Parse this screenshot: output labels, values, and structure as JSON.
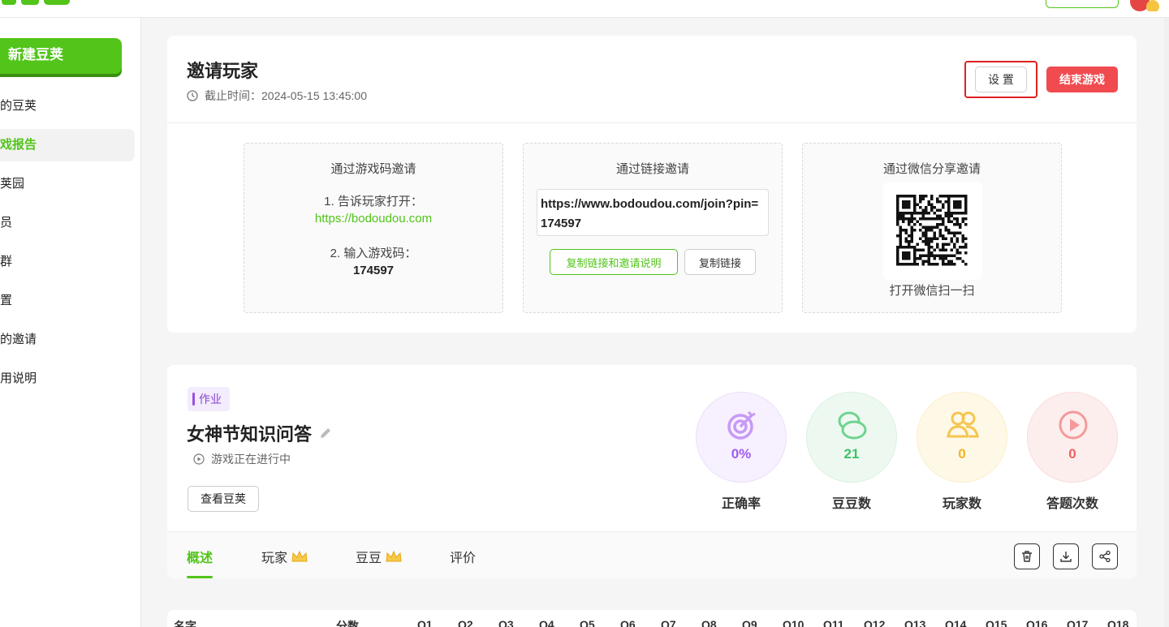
{
  "header": {
    "logo_icon": "doudou-logo",
    "colors": {
      "brand_green": "#52c41a",
      "danger_red": "#f04c50",
      "highlight_red": "#e02020"
    }
  },
  "sidebar": {
    "new_button": "新建豆荚",
    "items": [
      {
        "label": "的豆荚",
        "active": false
      },
      {
        "label": "戏报告",
        "active": true
      },
      {
        "label": "荚园",
        "active": false
      },
      {
        "label": "员",
        "active": false
      },
      {
        "label": "群",
        "active": false
      },
      {
        "label": "置",
        "active": false
      },
      {
        "label": "的邀请",
        "active": false
      },
      {
        "label": "用说明",
        "active": false
      }
    ]
  },
  "invite": {
    "title": "邀请玩家",
    "deadline": "截止时间：2024-05-15 13:45:00",
    "settings_button": "设 置",
    "end_button": "结束游戏",
    "by_code": {
      "title": "通过游戏码邀请",
      "step1": "1. 告诉玩家打开：",
      "step1_link": "https://bodoudou.com",
      "step2": "2. 输入游戏码：",
      "code": "174597"
    },
    "by_link": {
      "title": "通过链接邀请",
      "url": "https://www.bodoudou.com/join?pin=174597",
      "copy_with_instructions": "复制链接和邀请说明",
      "copy_link": "复制链接"
    },
    "by_wechat": {
      "title": "通过微信分享邀请",
      "caption": "打开微信扫一扫"
    }
  },
  "game": {
    "tag": "作业",
    "title": "女神节知识问答",
    "status": "游戏正在进行中",
    "view_button": "查看豆荚",
    "stats": [
      {
        "label": "正确率",
        "value": "0%",
        "icon": "target-icon",
        "color": "#a05cf0",
        "bg": "#f7f0fe"
      },
      {
        "label": "豆豆数",
        "value": "21",
        "icon": "beans-icon",
        "color": "#3fc06a",
        "bg": "#edf9f0"
      },
      {
        "label": "玩家数",
        "value": "0",
        "icon": "users-icon",
        "color": "#f5b325",
        "bg": "#fef8e6"
      },
      {
        "label": "答题次数",
        "value": "0",
        "icon": "play-icon",
        "color": "#f06060",
        "bg": "#fdeeee"
      }
    ],
    "tabs": [
      {
        "label": "概述",
        "active": true,
        "premium": false
      },
      {
        "label": "玩家",
        "active": false,
        "premium": true
      },
      {
        "label": "豆豆",
        "active": false,
        "premium": true
      },
      {
        "label": "评价",
        "active": false,
        "premium": false
      }
    ],
    "tools": [
      "trash-icon",
      "download-icon",
      "share-icon"
    ]
  },
  "table": {
    "columns": [
      "名字",
      "分数",
      "Q1",
      "Q2",
      "Q3",
      "Q4",
      "Q5",
      "Q6",
      "Q7",
      "Q8",
      "Q9",
      "Q10",
      "Q11",
      "Q12",
      "Q13",
      "Q14",
      "Q15",
      "Q16",
      "Q17",
      "Q18"
    ]
  }
}
